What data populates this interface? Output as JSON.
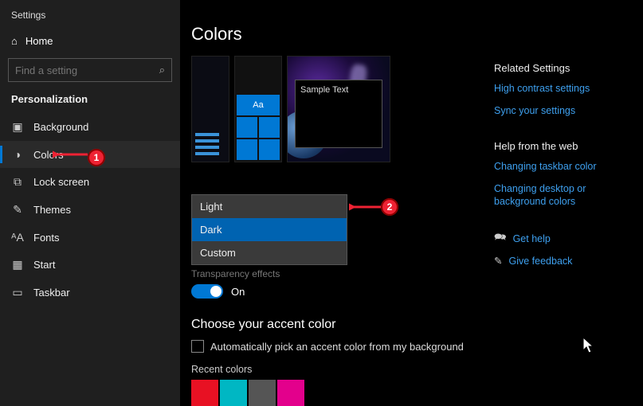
{
  "window": {
    "app_title": "Settings"
  },
  "sidebar": {
    "home_label": "Home",
    "search_placeholder": "Find a setting",
    "section_label": "Personalization",
    "items": [
      {
        "icon": "image-icon",
        "glyph": "▣",
        "label": "Background"
      },
      {
        "icon": "palette-icon",
        "glyph": "◑",
        "label": "Colors",
        "selected": true
      },
      {
        "icon": "lock-screen-icon",
        "glyph": "⧉",
        "label": "Lock screen"
      },
      {
        "icon": "themes-icon",
        "glyph": "✎",
        "label": "Themes"
      },
      {
        "icon": "fonts-icon",
        "glyph": "ᴬA",
        "label": "Fonts"
      },
      {
        "icon": "start-icon",
        "glyph": "▦",
        "label": "Start"
      },
      {
        "icon": "taskbar-icon",
        "glyph": "▭",
        "label": "Taskbar"
      }
    ]
  },
  "main": {
    "page_title": "Colors",
    "preview": {
      "tile_text": "Aa",
      "sample_window_text": "Sample Text"
    },
    "color_mode_dropdown": {
      "options": [
        {
          "label": "Light"
        },
        {
          "label": "Dark",
          "selected": true
        },
        {
          "label": "Custom"
        }
      ]
    },
    "transparency_label": "Transparency effects",
    "toggle_on_label": "On",
    "accent_heading": "Choose your accent color",
    "auto_accent_label": "Automatically pick an accent color from my background",
    "recent_colors_label": "Recent colors",
    "recent_colors": [
      "#e81123",
      "#00b7c3",
      "#555555",
      "#e3008c"
    ]
  },
  "right": {
    "related_heading": "Related Settings",
    "related_links": [
      "High contrast settings",
      "Sync your settings"
    ],
    "help_heading": "Help from the web",
    "help_links": [
      "Changing taskbar color",
      "Changing desktop or background colors"
    ],
    "get_help_label": "Get help",
    "feedback_label": "Give feedback"
  },
  "annotations": {
    "badge1": "1",
    "badge2": "2"
  }
}
